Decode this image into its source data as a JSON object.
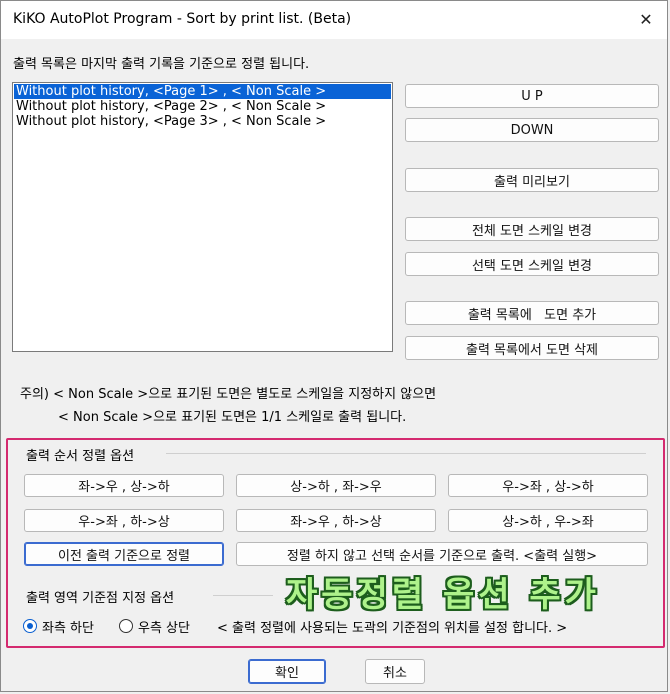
{
  "window": {
    "title": "KiKO AutoPlot Program - Sort by print list. (Beta)",
    "close_glyph": "✕"
  },
  "description": "출력 목록은 마지막 출력 기록을 기준으로 정렬 됩니다.",
  "list": {
    "items": [
      "Without plot history, <Page 1> , < Non Scale >",
      "Without plot history, <Page 2> , < Non Scale >",
      "Without plot history, <Page 3> , < Non Scale >"
    ],
    "selected_index": 0
  },
  "side_buttons": {
    "up": "U P",
    "down": "DOWN",
    "preview": "출력 미리보기",
    "scale_all": "전체 도면 스케일 변경",
    "scale_selected": "선택 도면 스케일 변경",
    "add_drawing": "출력 목록에   도면 추가",
    "delete_drawing": "출력 목록에서 도면 삭제"
  },
  "notes": {
    "line1": "주의) < Non Scale >으로 표기된 도면은 별도로 스케일을 지정하지 않으면",
    "line2": "< Non Scale >으로 표기된 도면은 1/1 스케일로 출력 됩니다."
  },
  "sort_options": {
    "label": "출력 순서 정렬 옵션",
    "buttons": [
      "좌->우 , 상->하",
      "상->하 , 좌->우",
      "우->좌 , 상->하",
      "우->좌 , 하->상",
      "좌->우 , 하->상",
      "상->하 , 우->좌"
    ],
    "previous": "이전 출력 기준으로 정렬",
    "no_sort": "정렬 하지 않고 선택 순서를 기준으로 출력. <출력 실행>"
  },
  "base_options": {
    "label": "출력 영역 기준점 지정 옵션",
    "radio_left_bottom": "좌측 하단",
    "radio_right_top": "우측 상단",
    "hint": "< 출력 정렬에 사용되는 도곽의 기준점의 위치를 설정 합니다. >",
    "selected": "radio_left_bottom"
  },
  "overlay_text": "자동정렬 옵션 추가",
  "footer": {
    "ok": "확인",
    "cancel": "취소"
  },
  "colors": {
    "selection": "#0a63d6",
    "highlight_frame": "#d42a6f",
    "overlay_fill": "#aef28b"
  }
}
